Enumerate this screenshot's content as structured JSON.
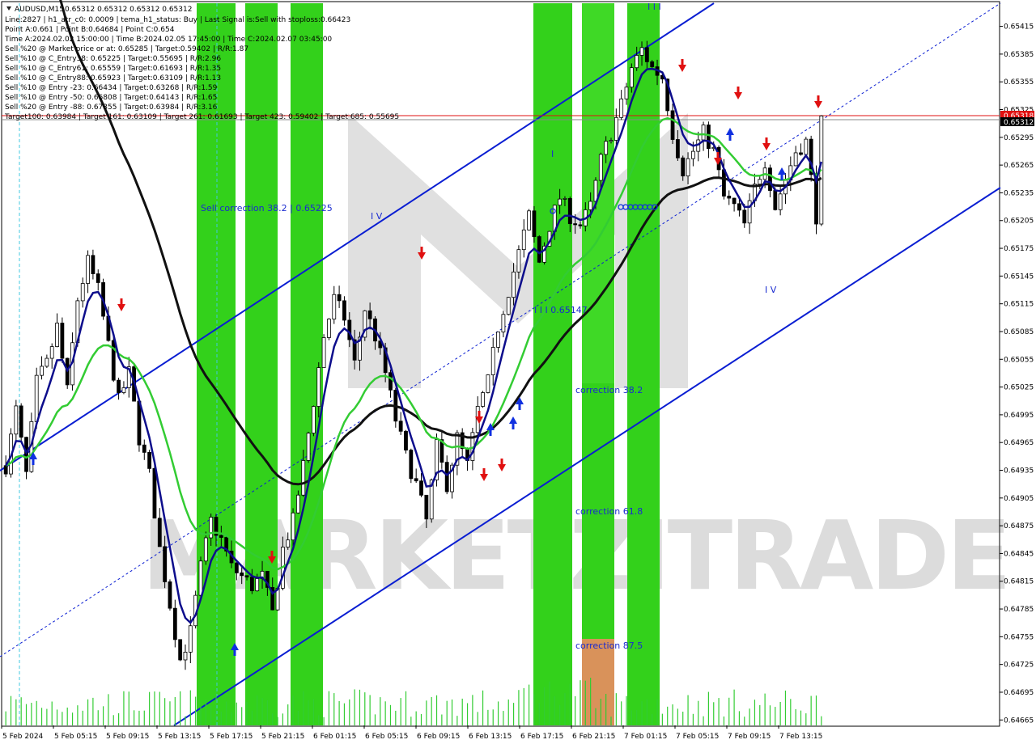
{
  "header": {
    "symbol": "AUDUSD,M15",
    "ohlc": "0.65312 0.65312 0.65312 0.65312",
    "info_lines": [
      "Line:2827  |  h1_atr_c0: 0.0009  |  tema_h1_status: Buy  |  Last Signal is:Sell with stoploss:0.66423",
      "Point A:0.661  |  Point B:0.64684  |  Point C:0.654",
      "Time A:2024.02.02 15:00:00  |  Time B:2024.02.05 17:45:00  |  Time C:2024.02.07 03:45:00",
      "Sell %20 @ Market price or at: 0.65285  |  Target:0.59402  |  R/R:1.87",
      "Sell %10 @ C_Entry38: 0.65225  |  Target:0.55695  |  R/R:2.96",
      "Sell %10 @ C_Entry61: 0.65559  |  Target:0.61693  |  R/R:1.35",
      "Sell %10 @ C_Entry88: 0.65923  |  Target:0.63109  |  R/R:1.13",
      "Sell %10 @ Entry -23: 0.66434  |  Target:0.63268  |  R/R:1.59",
      "Sell %10 @ Entry -50: 0.66808  |  Target:0.64143  |  R/R:1.65",
      "Sell %20 @ Entry -88: 0.67355  |  Target:0.63984  |  R/R:3.16",
      "Target100: 0.63984  |  Target 161: 0.63109  |  Target 261: 0.61693  |  Target 423: 0.59402  |  Target 685: 0.55695"
    ]
  },
  "watermark": "MARKETZITRADE",
  "annotations": {
    "sell_correction": "Sell correction 38.2 | 0.65225",
    "level_label": "I I I 0.65147",
    "wave_iv_left": "I V",
    "wave_iv_right": "I V",
    "wave_i": "I",
    "wave_top": "I I I",
    "correction_382": "correction 38.2",
    "correction_618": "correction 61.8",
    "correction_875": "correction 87.5"
  },
  "colors": {
    "bullish_zone": "#33d11b",
    "bullish_zone_light": "#7cf514",
    "bearish_zone": "#d9925a",
    "channel": "#0a1ed2",
    "ma_fast": "#0d0d8c",
    "ma_mid": "#33cc33",
    "ma_slow": "#111111",
    "price_line": "#e01010",
    "sell_arrow": "#e01010",
    "buy_arrow": "#1030e0"
  },
  "chart_data": {
    "type": "candlestick",
    "symbol": "AUDUSD",
    "timeframe": "M15",
    "current_price": "0.65312",
    "red_line_price": "0.65318",
    "y_ticks": [
      "0.65415",
      "0.65385",
      "0.65355",
      "0.65325",
      "0.65295",
      "0.65265",
      "0.65235",
      "0.65205",
      "0.65175",
      "0.65145",
      "0.65115",
      "0.65085",
      "0.65055",
      "0.65025",
      "0.64995",
      "0.64965",
      "0.64935",
      "0.64905",
      "0.64875",
      "0.64845",
      "0.64815",
      "0.64785",
      "0.64755",
      "0.64725",
      "0.64695",
      "0.64665"
    ],
    "x_ticks": [
      "5 Feb 2024",
      "5 Feb 05:15",
      "5 Feb 09:15",
      "5 Feb 13:15",
      "5 Feb 17:15",
      "5 Feb 21:15",
      "6 Feb 01:15",
      "6 Feb 05:15",
      "6 Feb 09:15",
      "6 Feb 13:15",
      "6 Feb 17:15",
      "6 Feb 21:15",
      "7 Feb 01:15",
      "7 Feb 05:15",
      "7 Feb 09:15",
      "7 Feb 13:15"
    ],
    "ylim": [
      0.6466,
      0.6544
    ],
    "close_path": [
      [
        0,
        0.6494
      ],
      [
        2,
        0.65
      ],
      [
        4,
        0.6493
      ],
      [
        6,
        0.6503
      ],
      [
        8,
        0.6505
      ],
      [
        10,
        0.6509
      ],
      [
        12,
        0.6502
      ],
      [
        14,
        0.6512
      ],
      [
        16,
        0.6516
      ],
      [
        18,
        0.6513
      ],
      [
        20,
        0.6507
      ],
      [
        22,
        0.6501
      ],
      [
        24,
        0.6504
      ],
      [
        26,
        0.6497
      ],
      [
        28,
        0.6493
      ],
      [
        30,
        0.6485
      ],
      [
        32,
        0.6479
      ],
      [
        34,
        0.6473
      ],
      [
        36,
        0.6476
      ],
      [
        38,
        0.6483
      ],
      [
        40,
        0.6488
      ],
      [
        42,
        0.6486
      ],
      [
        44,
        0.6483
      ],
      [
        46,
        0.6482
      ],
      [
        48,
        0.6481
      ],
      [
        50,
        0.6482
      ],
      [
        52,
        0.6478
      ],
      [
        54,
        0.6485
      ],
      [
        56,
        0.6488
      ],
      [
        58,
        0.6494
      ],
      [
        60,
        0.6501
      ],
      [
        62,
        0.6508
      ],
      [
        64,
        0.6512
      ],
      [
        66,
        0.651
      ],
      [
        68,
        0.6505
      ],
      [
        70,
        0.6511
      ],
      [
        72,
        0.6508
      ],
      [
        74,
        0.6504
      ],
      [
        76,
        0.6499
      ],
      [
        78,
        0.6495
      ],
      [
        80,
        0.6492
      ],
      [
        82,
        0.6488
      ],
      [
        84,
        0.6496
      ],
      [
        86,
        0.6492
      ],
      [
        88,
        0.6497
      ],
      [
        90,
        0.6494
      ],
      [
        92,
        0.65
      ],
      [
        94,
        0.6503
      ],
      [
        96,
        0.6509
      ],
      [
        98,
        0.6513
      ],
      [
        100,
        0.6517
      ],
      [
        102,
        0.6521
      ],
      [
        104,
        0.6516
      ],
      [
        106,
        0.652
      ],
      [
        108,
        0.6523
      ],
      [
        110,
        0.6521
      ],
      [
        112,
        0.652
      ],
      [
        114,
        0.6522
      ],
      [
        116,
        0.6527
      ],
      [
        118,
        0.653
      ],
      [
        120,
        0.6533
      ],
      [
        122,
        0.6537
      ],
      [
        124,
        0.6539
      ],
      [
        126,
        0.6537
      ],
      [
        128,
        0.6536
      ],
      [
        130,
        0.653
      ],
      [
        132,
        0.6526
      ],
      [
        134,
        0.6528
      ],
      [
        136,
        0.653
      ],
      [
        138,
        0.6528
      ],
      [
        140,
        0.6523
      ],
      [
        142,
        0.6522
      ],
      [
        144,
        0.652
      ],
      [
        146,
        0.6524
      ],
      [
        148,
        0.6527
      ],
      [
        150,
        0.6522
      ],
      [
        152,
        0.6525
      ],
      [
        154,
        0.6528
      ],
      [
        156,
        0.6529
      ],
      [
        158,
        0.6521
      ],
      [
        159,
        0.6531
      ]
    ],
    "series": [
      {
        "name": "TEMA",
        "color": "#0d0d8c"
      },
      {
        "name": "MA",
        "color": "#33cc33"
      },
      {
        "name": "MA200",
        "color": "#111111"
      }
    ]
  }
}
